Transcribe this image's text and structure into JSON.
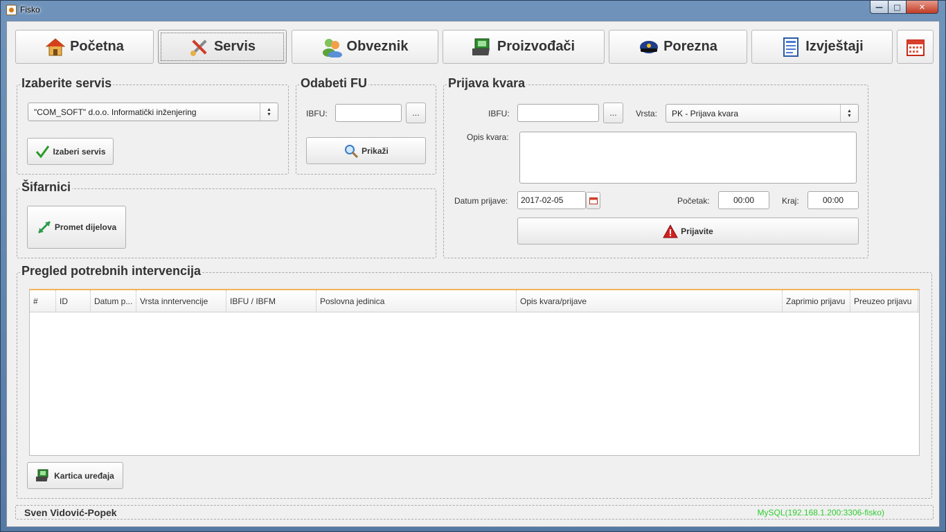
{
  "window": {
    "title": "Fisko",
    "minimize": "—",
    "maximize": "□",
    "close": "✕"
  },
  "nav": {
    "pocetna": "Početna",
    "servis": "Servis",
    "obveznik": "Obveznik",
    "proizvodaci": "Proizvođači",
    "porezna": "Porezna",
    "izvjestaji": "Izvještaji"
  },
  "izaberite": {
    "title": "Izaberite servis",
    "combo_value": "\"COM_SOFT\" d.o.o. Informatički inženjering",
    "button": "Izaberi servis"
  },
  "odabeti": {
    "title": "Odabeti FU",
    "ibfu_label": "IBFU:",
    "ibfu_value": "",
    "browse": "...",
    "button": "Prikaži"
  },
  "sifarnici": {
    "title": "Šifarnici",
    "button": "Promet dijelova"
  },
  "prijava": {
    "title": "Prijava kvara",
    "ibfu_label": "IBFU:",
    "ibfu_value": "",
    "browse": "...",
    "vrsta_label": "Vrsta:",
    "vrsta_value": "PK - Prijava kvara",
    "opis_label": "Opis kvara:",
    "datum_label": "Datum prijave:",
    "datum_value": "2017-02-05",
    "pocetak_label": "Početak:",
    "pocetak_value": "00:00",
    "kraj_label": "Kraj:",
    "kraj_value": "00:00",
    "button": "Prijavite"
  },
  "pregled": {
    "title": "Pregled potrebnih intervencija",
    "columns": [
      "#",
      "ID",
      "Datum p...",
      "Vrsta inntervencije",
      "IBFU / IBFM",
      "Poslovna jedinica",
      "Opis kvara/prijave",
      "Zaprimio prijavu",
      "Preuzeo prijavu"
    ],
    "rows": [],
    "button": "Kartica uređaja"
  },
  "status": {
    "user": "Sven Vidović-Popek",
    "db": "MySQL(192.168.1.200:3306-fisko)"
  },
  "colors": {
    "accent": "#f2b25a",
    "db_status": "#2ecc2e",
    "warning": "#d42020"
  }
}
